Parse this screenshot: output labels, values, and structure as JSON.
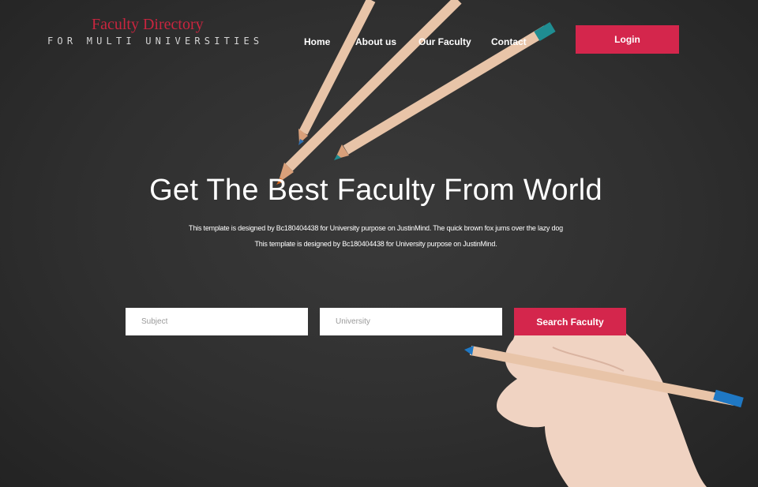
{
  "brand": {
    "title": "Faculty Directory",
    "subtitle": "FOR MULTI UNIVERSITIES"
  },
  "nav": {
    "items": [
      {
        "label": "Home"
      },
      {
        "label": "About us"
      },
      {
        "label": "Our Faculty"
      },
      {
        "label": "Contact"
      }
    ],
    "login_label": "Login"
  },
  "hero": {
    "title": "Get The Best Faculty From World",
    "desc_line1": "This template is designed by Bc180404438 for University purpose on JustinMind. The quick brown fox jums over the lazy dog",
    "desc_line2": "This template is designed by Bc180404438 for University purpose on JustinMind."
  },
  "search": {
    "subject_placeholder": "Subject",
    "university_placeholder": "University",
    "button_label": "Search Faculty"
  },
  "colors": {
    "accent": "#d4264c",
    "background": "#2e2e2e",
    "logo_red": "#c9253f"
  }
}
